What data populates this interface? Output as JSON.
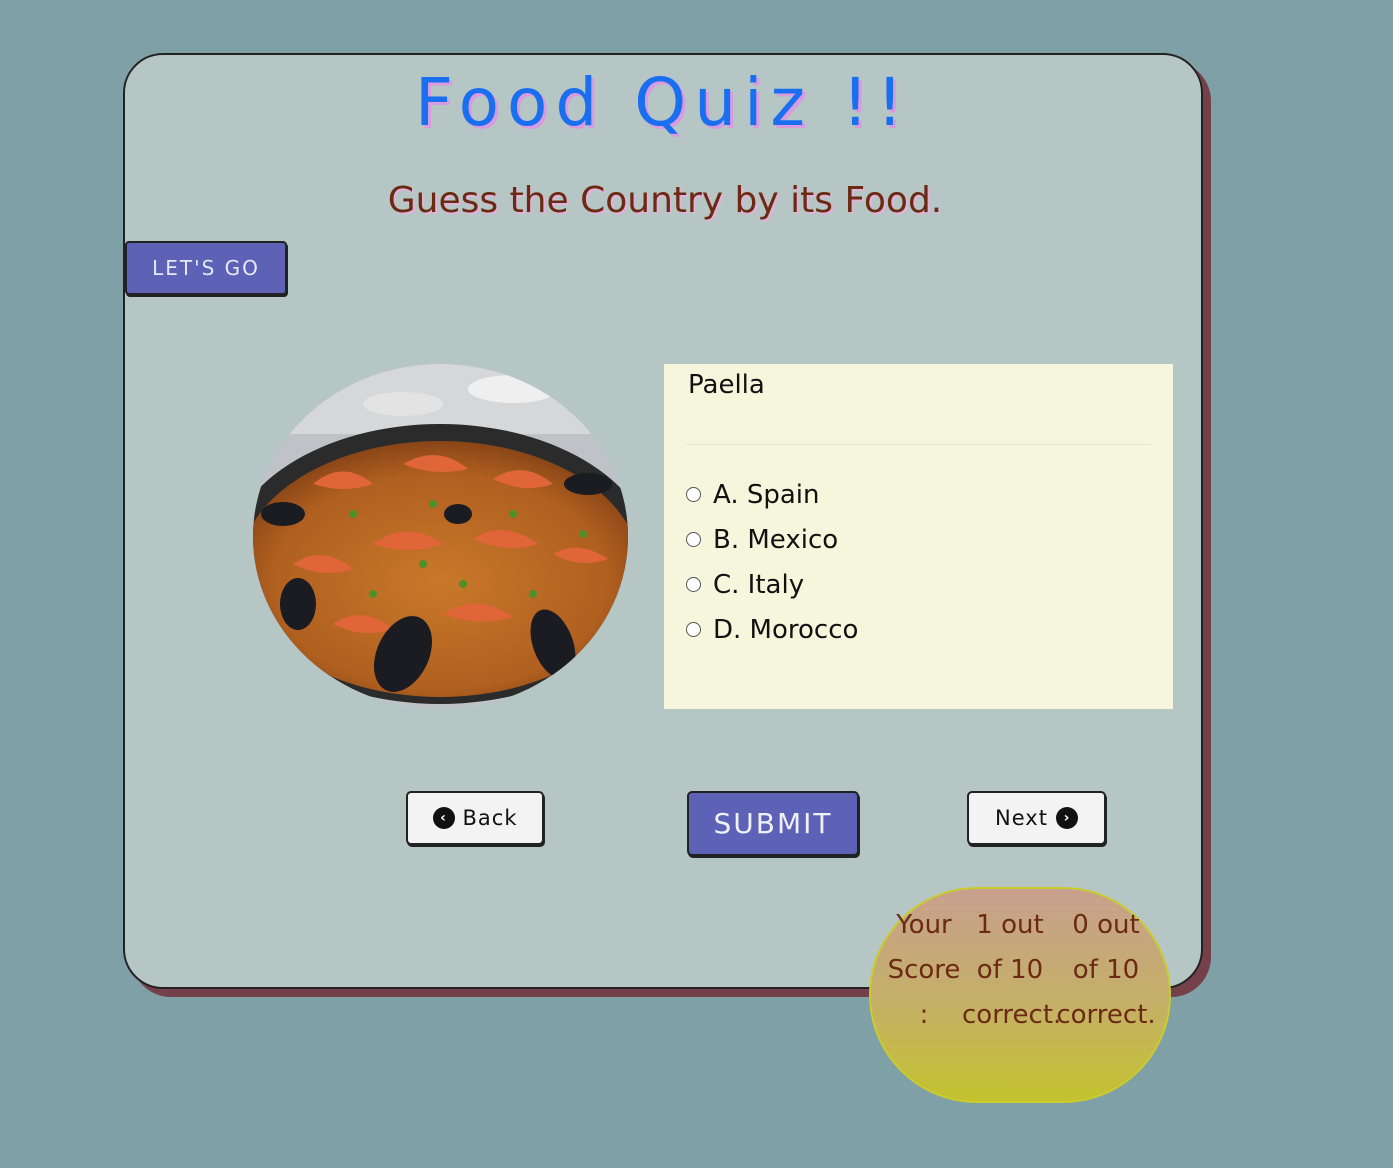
{
  "header": {
    "title": "Food Quiz !!",
    "subtitle": "Guess the Country by its Food."
  },
  "start_button": "LET'S GO",
  "question": {
    "food_name": "Paella",
    "image_icon": "paella-dish-image",
    "options": [
      "A. Spain",
      "B. Mexico",
      "C. Italy",
      "D. Morocco"
    ]
  },
  "navigation": {
    "back_label": "Back",
    "back_icon": "chevron-left-circle-icon",
    "submit_label": "SUBMIT",
    "next_label": "Next",
    "next_icon": "chevron-right-circle-icon"
  },
  "score": {
    "label_line1": "Your",
    "label_line2": "Score",
    "label_line3": ":",
    "first_line1": "1 out",
    "first_line2": "of 10",
    "first_line3": "correct.",
    "second_line1": "0 out",
    "second_line2": "of 10",
    "second_line3": "correct."
  },
  "colors": {
    "background": "#80a0a7",
    "card": "#b6c6c5",
    "card_shadow": "#74414a",
    "title": "#1a6ff0",
    "subtitle": "#6b2a14",
    "button_primary": "#5d62b6",
    "question_box": "#f6f6dc",
    "score_bubble_top": "#c8a08e",
    "score_bubble_bottom": "#c4c22e"
  }
}
